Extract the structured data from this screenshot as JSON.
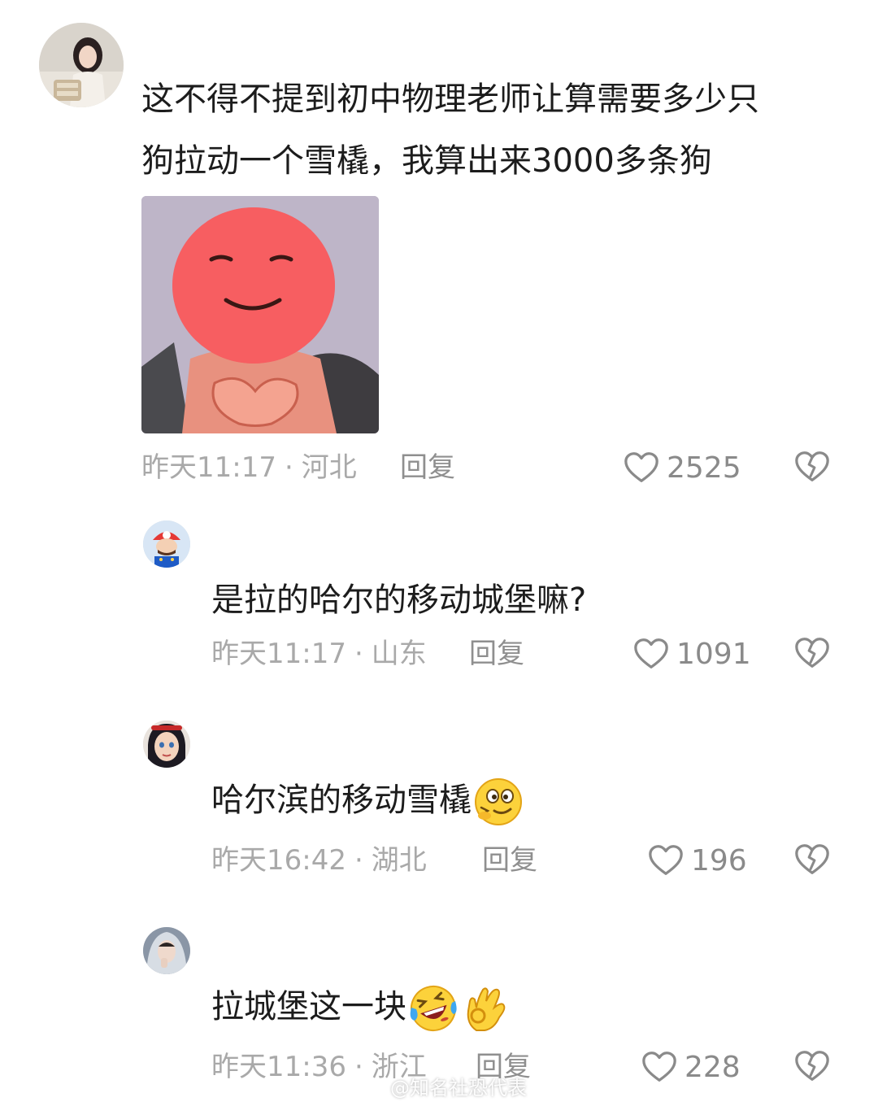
{
  "comments": [
    {
      "text_lines": [
        "这不得不提到初中物理老师让算需要多少只",
        "狗拉动一个雪橇，我算出来3000多条狗"
      ],
      "time": "昨天11:17",
      "location": "河北",
      "reply_label": "回复",
      "likes": "2525",
      "avatar_icon": "girl-avatar",
      "sticker_icon": "red-face-meme-sticker"
    },
    {
      "text": "是拉的哈尔的移动城堡嘛?",
      "time": "昨天11:17",
      "location": "山东",
      "reply_label": "回复",
      "likes": "1091",
      "avatar_icon": "mario-avatar"
    },
    {
      "text": "哈尔滨的移动雪橇",
      "emoji": [
        "drooling-face-emoji"
      ],
      "time": "昨天16:42",
      "location": "湖北",
      "reply_label": "回复",
      "likes": "196",
      "avatar_icon": "cartoon-girl-avatar"
    },
    {
      "text": "拉城堡这一块",
      "emoji": [
        "laughing-crying-emoji",
        "ok-hand-emoji"
      ],
      "time": "昨天11:36",
      "location": "浙江",
      "reply_label": "回复",
      "likes": "228",
      "avatar_icon": "veiled-woman-avatar"
    }
  ],
  "separator": "·",
  "watermark": "@知名社恐代表",
  "colors": {
    "meta_text": "#a9a9a9",
    "body_text": "#1c1c1c",
    "icon_gray": "#8a8a8a"
  }
}
